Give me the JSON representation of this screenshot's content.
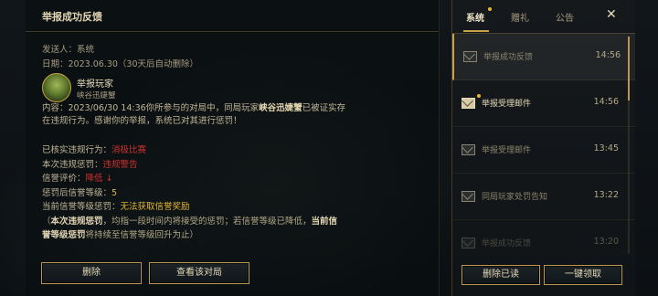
{
  "mail_detail": {
    "title": "举报成功反馈",
    "sender_label": "发送人：",
    "sender_value": "系统",
    "date_label": "日期：",
    "date_value": "2023.06.30（30天后自动删除）",
    "player_title": "举报玩家",
    "player_name": "峡谷迅婕蟹",
    "content_prefix": "内容：2023/06/30 14:36你所参与的对局中，同局玩家",
    "content_player": "峡谷迅婕蟹",
    "content_mid": "已被证实存",
    "content_line2": "在违规行为。感谢你的举报，系统已对其进行惩罚！",
    "violation_label": "已核实违规行为：",
    "violation_value": "消极比赛",
    "penalty_label": "本次违规惩罚：",
    "penalty_value": "违规警告",
    "credit_label": "信誉评价：",
    "credit_value": "降低 ↓",
    "credit_level_label": "惩罚后信誉等级：",
    "credit_level_value": "5",
    "current_level_label": "当前信誉等级惩罚：",
    "current_level_value": "无法获取信誉奖励",
    "note_open": "（",
    "note_b1": "本次违规惩罚",
    "note_t1": "，均指一段时间内将接受的惩罚；若信誉等级已降低，",
    "note_b2a": "当前信",
    "note_b2b": "誉等级惩罚",
    "note_t2": "将持续至信誉等级回升为止）"
  },
  "buttons": {
    "delete": "删除",
    "view_match": "查看该对局",
    "delete_read": "删除已读",
    "collect_all": "一键领取"
  },
  "tabs": [
    {
      "label": "系统",
      "active": true,
      "badge": true
    },
    {
      "label": "赠礼",
      "active": false,
      "badge": false
    },
    {
      "label": "公告",
      "active": false,
      "badge": false
    }
  ],
  "close_icon": "✕",
  "mail_list": [
    {
      "title": "举报成功反馈",
      "time": "14:56",
      "unread": false,
      "selected": true,
      "icon": "envelope-icon"
    },
    {
      "title": "举报受理邮件",
      "time": "14:56",
      "unread": true,
      "selected": false,
      "icon": "envelope-icon"
    },
    {
      "title": "举报受理邮件",
      "time": "13:45",
      "unread": false,
      "selected": false,
      "icon": "envelope-icon"
    },
    {
      "title": "同局玩家处罚告知",
      "time": "13:22",
      "unread": false,
      "selected": false,
      "icon": "envelope-icon"
    },
    {
      "title": "举报成功反馈",
      "time": "13:20",
      "unread": false,
      "selected": false,
      "icon": "envelope-icon"
    }
  ],
  "colors": {
    "accent_gold": "#c9a24a",
    "red": "#d0322e",
    "yellow": "#e3b734"
  }
}
